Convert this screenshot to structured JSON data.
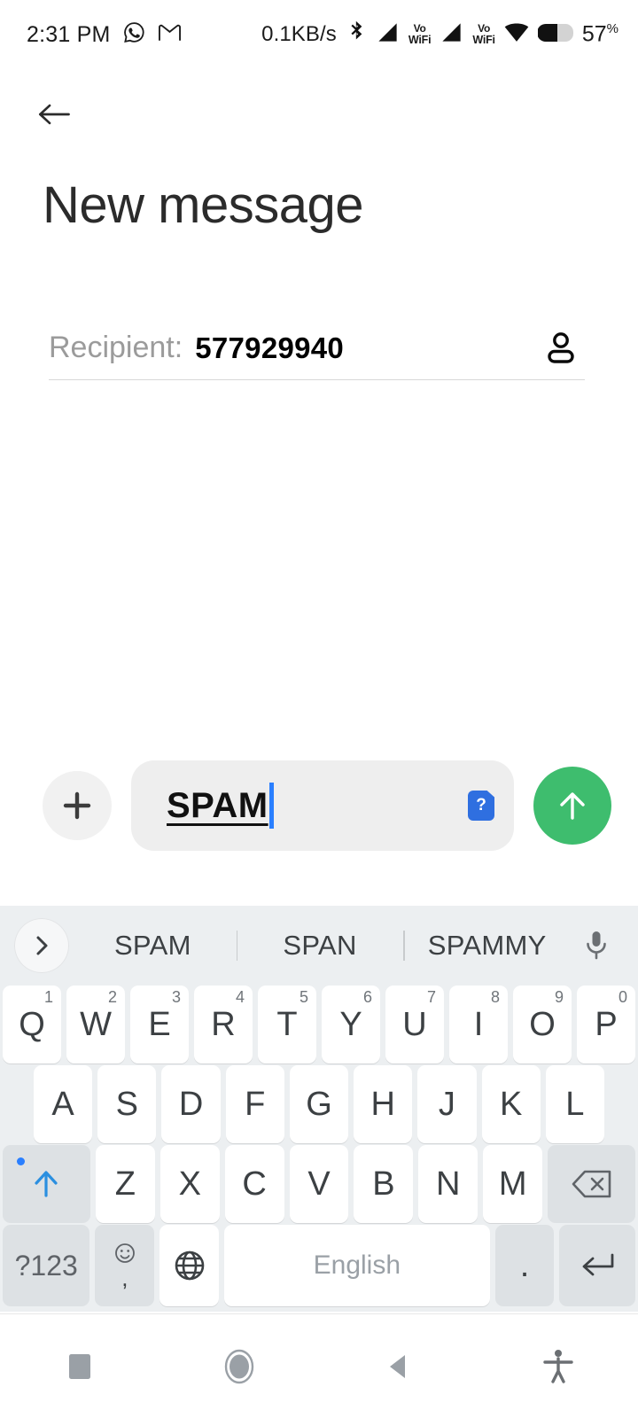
{
  "status_bar": {
    "time": "2:31 PM",
    "app_icons": [
      "whatsapp-icon",
      "gmail-icon"
    ],
    "network_speed": "0.1KB/s",
    "bluetooth": "bluetooth-icon",
    "signal_1": "signal-bars-icon",
    "volte_1_top": "Vo",
    "volte_1_bottom": "WiFi",
    "signal_2": "signal-bars-icon",
    "volte_2_top": "Vo",
    "volte_2_bottom": "WiFi",
    "wifi": "wifi-icon",
    "battery_percent": "57",
    "battery_unit": "%"
  },
  "app_bar": {
    "back_label": "back-arrow",
    "title": "New message"
  },
  "recipient": {
    "label": "Recipient:",
    "value": "577929940",
    "contact_icon": "person-icon"
  },
  "compose": {
    "attach_label": "+",
    "text": "SPAM",
    "sim_badge": "?",
    "send_icon": "arrow-up-icon"
  },
  "keyboard": {
    "expand_icon": "chevron-right-icon",
    "suggestions": [
      "SPAM",
      "SPAN",
      "SPAMMY"
    ],
    "mic_icon": "microphone-icon",
    "row1": [
      {
        "key": "Q",
        "num": "1"
      },
      {
        "key": "W",
        "num": "2"
      },
      {
        "key": "E",
        "num": "3"
      },
      {
        "key": "R",
        "num": "4"
      },
      {
        "key": "T",
        "num": "5"
      },
      {
        "key": "Y",
        "num": "6"
      },
      {
        "key": "U",
        "num": "7"
      },
      {
        "key": "I",
        "num": "8"
      },
      {
        "key": "O",
        "num": "9"
      },
      {
        "key": "P",
        "num": "0"
      }
    ],
    "row2": [
      "A",
      "S",
      "D",
      "F",
      "G",
      "H",
      "J",
      "K",
      "L"
    ],
    "row3": [
      "Z",
      "X",
      "C",
      "V",
      "B",
      "N",
      "M"
    ],
    "shift_icon": "shift-arrow-icon",
    "backspace_icon": "backspace-icon",
    "row4": {
      "symbols": "?123",
      "emoji_icon": "emoji-smiley-icon",
      "comma": ",",
      "globe_icon": "language-globe-icon",
      "space_label": "English",
      "period": ".",
      "enter_icon": "enter-return-icon"
    }
  },
  "nav_bar": {
    "recents": "recents-square-icon",
    "home": "home-circle-icon",
    "back": "back-triangle-icon",
    "accessibility": "accessibility-icon"
  },
  "colors": {
    "send_green": "#3ebd6e",
    "cursor_blue": "#2a7fff",
    "sim_blue": "#2f6fe0",
    "shift_blue": "#2a7fff",
    "keyboard_bg": "#eceff1"
  }
}
